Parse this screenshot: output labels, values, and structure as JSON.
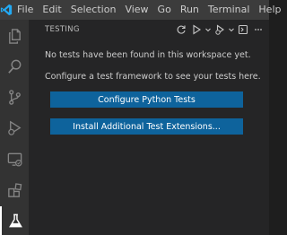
{
  "menubar": {
    "items": [
      "File",
      "Edit",
      "Selection",
      "View",
      "Go",
      "Run",
      "Terminal",
      "Help"
    ]
  },
  "activitybar": {
    "icons": [
      "files-icon",
      "search-icon",
      "source-control-icon",
      "run-debug-icon",
      "remote-explorer-icon",
      "extensions-icon",
      "testing-icon"
    ],
    "active": "testing-icon"
  },
  "sidebar": {
    "title": "TESTING",
    "actions": [
      "refresh-icon",
      "run-all-icon",
      "run-dropdown-icon",
      "debug-all-icon",
      "debug-dropdown-icon",
      "show-output-icon",
      "more-actions-icon"
    ]
  },
  "welcome": {
    "line1": "No tests have been found in this workspace yet.",
    "line2": "Configure a test framework to see your tests here.",
    "configure_button": "Configure Python Tests",
    "install_button": "Install Additional Test Extensions..."
  },
  "colors": {
    "titlebar": "#3c3c3c",
    "activitybar": "#333333",
    "sidebar": "#252526",
    "button": "#0e639c",
    "logo": "#23a9f2"
  }
}
